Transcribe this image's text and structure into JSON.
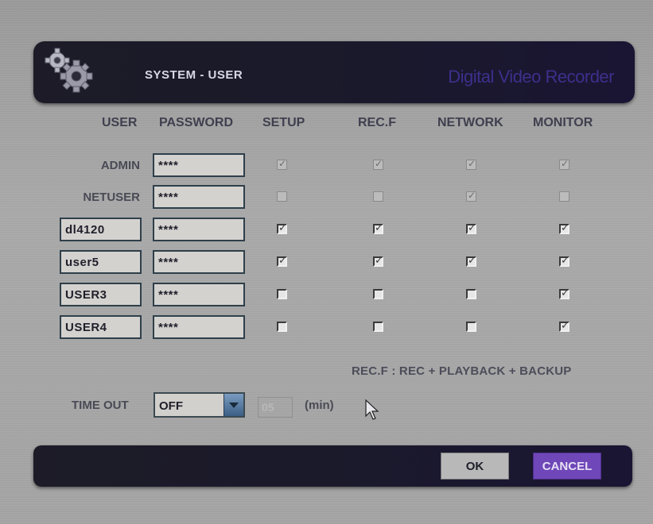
{
  "header": {
    "title": "SYSTEM - USER",
    "brand": "Digital Video Recorder"
  },
  "columns": [
    "USER",
    "PASSWORD",
    "SETUP",
    "REC.F",
    "NETWORK",
    "MONITOR"
  ],
  "users": [
    {
      "name": "ADMIN",
      "editable": false,
      "password": "****",
      "setup": true,
      "recf": true,
      "network": true,
      "monitor": true,
      "perm_enabled": false
    },
    {
      "name": "NETUSER",
      "editable": false,
      "password": "****",
      "setup": false,
      "recf": false,
      "network": true,
      "monitor": false,
      "perm_enabled": false
    },
    {
      "name": "dl4120",
      "editable": true,
      "password": "****",
      "setup": true,
      "recf": true,
      "network": true,
      "monitor": true,
      "perm_enabled": true
    },
    {
      "name": "user5",
      "editable": true,
      "password": "****",
      "setup": true,
      "recf": true,
      "network": true,
      "monitor": true,
      "perm_enabled": true
    },
    {
      "name": "USER3",
      "editable": true,
      "password": "****",
      "setup": false,
      "recf": false,
      "network": false,
      "monitor": true,
      "perm_enabled": true
    },
    {
      "name": "USER4",
      "editable": true,
      "password": "****",
      "setup": false,
      "recf": false,
      "network": false,
      "monitor": true,
      "perm_enabled": true
    }
  ],
  "note": "REC.F : REC + PLAYBACK + BACKUP",
  "timeout": {
    "label": "TIME OUT",
    "value": "OFF",
    "minutes": "05",
    "unit": "(min)"
  },
  "buttons": {
    "ok": "OK",
    "cancel": "CANCEL"
  },
  "colors": {
    "bar": "#1b1a2b",
    "brand": "#3d2f8c",
    "cancel": "#6f47b8",
    "field": "#d4d2cf"
  }
}
